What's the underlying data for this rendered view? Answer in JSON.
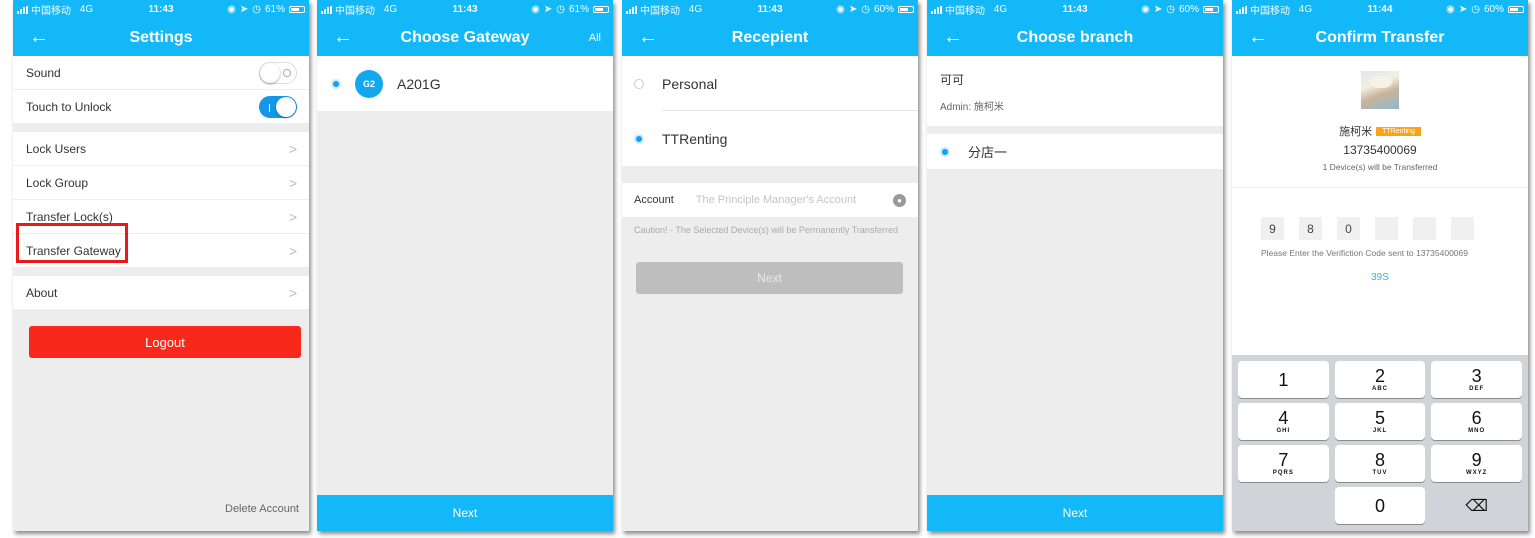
{
  "colors": {
    "primary": "#12b8f8",
    "danger": "#f8291a",
    "highlight": "#e81a1a",
    "badge": "#f9a31b"
  },
  "screens": [
    {
      "status": {
        "carrier": "中国移动",
        "network": "4G",
        "time": "11:43",
        "battery": "61%"
      },
      "title": "Settings",
      "toggles": [
        {
          "label": "Sound",
          "on": false
        },
        {
          "label": "Touch to Unlock",
          "on": true
        }
      ],
      "items": [
        "Lock Users",
        "Lock Group",
        "Transfer Lock(s)",
        "Transfer Gateway",
        "About"
      ],
      "highlighted_item": "Transfer Gateway",
      "logout_label": "Logout",
      "delete_label": "Delete Account"
    },
    {
      "status": {
        "carrier": "中国移动",
        "network": "4G",
        "time": "11:43",
        "battery": "61%"
      },
      "title": "Choose Gateway",
      "right_action": "All",
      "gateway": {
        "icon": "G2",
        "name": "A201G",
        "selected": true
      },
      "next_label": "Next"
    },
    {
      "status": {
        "carrier": "中国移动",
        "network": "4G",
        "time": "11:43",
        "battery": "60%"
      },
      "title": "Recepient",
      "options": [
        {
          "label": "Personal",
          "selected": false
        },
        {
          "label": "TTRenting",
          "selected": true
        }
      ],
      "account_label": "Account",
      "account_placeholder": "The Principle Manager's Account",
      "caution": "Caution! - The Selected Device(s) will be Permanently Transferred",
      "next_label": "Next"
    },
    {
      "status": {
        "carrier": "中国移动",
        "network": "4G",
        "time": "11:43",
        "battery": "60%"
      },
      "title": "Choose branch",
      "company": "可可",
      "admin": "Admin: 施柯米",
      "branch": {
        "label": "分店一",
        "selected": true
      },
      "next_label": "Next"
    },
    {
      "status": {
        "carrier": "中国移动",
        "network": "4G",
        "time": "11:44",
        "battery": "60%"
      },
      "title": "Confirm Transfer",
      "name": "施柯米",
      "badge": "TTRenting",
      "phone": "13735400069",
      "devices": "1 Device(s) will be Transferred",
      "code": [
        "9",
        "8",
        "0",
        "",
        "",
        ""
      ],
      "prompt": "Please Enter the Verifiction Code sent to 13735400069",
      "timer": "39S",
      "keys": [
        {
          "n": "1",
          "s": ""
        },
        {
          "n": "2",
          "s": "ABC"
        },
        {
          "n": "3",
          "s": "DEF"
        },
        {
          "n": "4",
          "s": "GHI"
        },
        {
          "n": "5",
          "s": "JKL"
        },
        {
          "n": "6",
          "s": "MNO"
        },
        {
          "n": "7",
          "s": "PQRS"
        },
        {
          "n": "8",
          "s": "TUV"
        },
        {
          "n": "9",
          "s": "WXYZ"
        },
        {
          "n": "",
          "s": ""
        },
        {
          "n": "0",
          "s": ""
        },
        {
          "n": "⌫",
          "s": ""
        }
      ]
    }
  ]
}
